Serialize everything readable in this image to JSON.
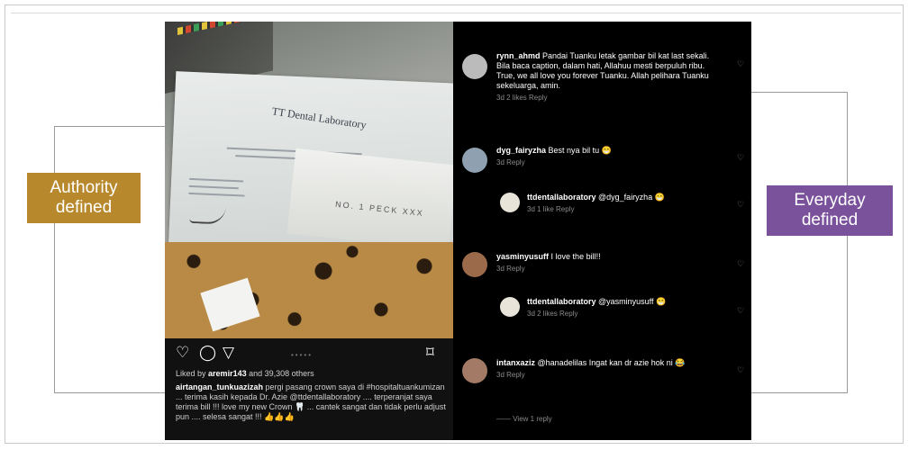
{
  "labels": {
    "authority": "Authority\ndefined",
    "everyday": "Everyday\ndefined"
  },
  "colors": {
    "authority": "#b8892c",
    "everyday": "#7a519b",
    "panel_bg": "#000000"
  },
  "post": {
    "photo": {
      "lab_name": "TT Dental Laboratory",
      "envelope_text": "NO. 1 PECK XXX"
    },
    "icons": [
      "heart-icon",
      "comment-icon",
      "share-icon",
      "bookmark-icon"
    ],
    "likes_prefix": "Liked by",
    "likes_user": "aremir143",
    "likes_suffix": "and 39,308 others",
    "caption_user": "airtangan_tunkuazizah",
    "caption_text": "pergi pasang crown saya di #hospitaltuankumizan ... terima kasih kepada Dr. Azie @ttdentallaboratory .... terperanjat saya terima bill !!! love my new Crown 🦷 ... cantek sangat dan tidak perlu adjust pun .... selesa sangat !!! 👍👍👍"
  },
  "comments": [
    {
      "user": "rynn_ahmd",
      "text": "Pandai Tuanku letak gambar bil kat last sekali. Bila baca caption, dalam hati, Allahuu mesti berpuluh ribu. True, we all love you forever Tuanku. Allah pelihara Tuanku sekeluarga, amin.",
      "meta": "3d   2 likes   Reply"
    },
    {
      "user": "dyg_fairyzha",
      "text": "Best nya bil tu 😁",
      "meta": "3d   Reply"
    },
    {
      "user": "ttdentallaboratory",
      "text": "@dyg_fairyzha 😁",
      "meta": "3d   1 like   Reply"
    },
    {
      "user": "yasminyusuff",
      "text": "I love the bill!!",
      "meta": "3d   Reply"
    },
    {
      "user": "ttdentallaboratory",
      "text": "@yasminyusuff 😁",
      "meta": "3d   2 likes   Reply"
    },
    {
      "user": "intanxaziz",
      "text": "@hanadelilas Ingat kan dr azie hok ni 😂",
      "meta": "3d   Reply"
    }
  ],
  "view_replies": "View 1 reply"
}
